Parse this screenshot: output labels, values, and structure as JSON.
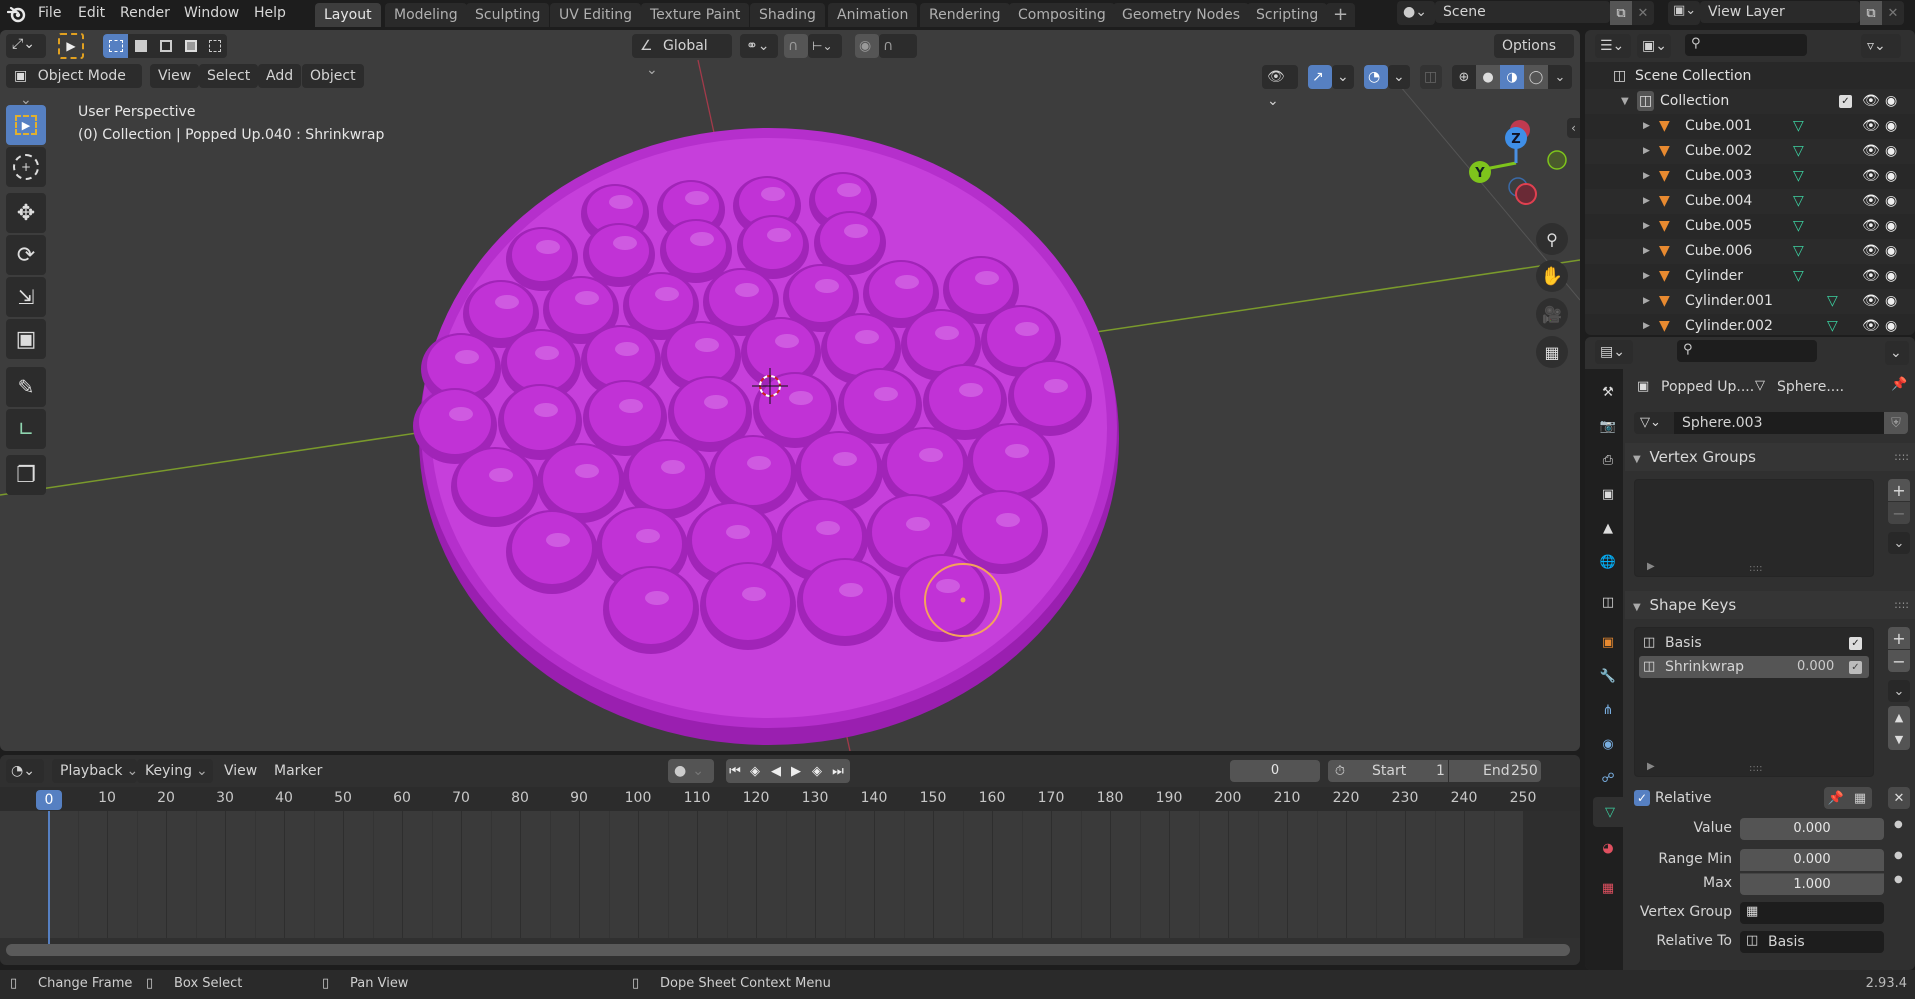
{
  "app": {
    "logo": "blender-logo-icon",
    "version": "2.93.4"
  },
  "topbar": {
    "menus": [
      "File",
      "Edit",
      "Render",
      "Window",
      "Help"
    ],
    "workspaces": [
      "Layout",
      "Modeling",
      "Sculpting",
      "UV Editing",
      "Texture Paint",
      "Shading",
      "Animation",
      "Rendering",
      "Compositing",
      "Geometry Nodes",
      "Scripting"
    ],
    "active_workspace": "Layout",
    "add_workspace": "+",
    "scene": "Scene",
    "view_layer": "View Layer"
  },
  "tool_settings": {
    "transform_orientation": "Global",
    "options_label": "Options"
  },
  "viewport": {
    "mode": "Object Mode",
    "menus": [
      "View",
      "Select",
      "Add",
      "Object"
    ],
    "info_line1": "User Perspective",
    "info_line2": "(0) Collection | Popped Up.040 : Shrinkwrap",
    "object_color": "#c132d6",
    "selection_color": "#f5a35b",
    "gizmo": {
      "x": "X",
      "y": "Y",
      "z": "Z"
    },
    "tools": [
      "select-box",
      "cursor",
      "move",
      "rotate",
      "scale",
      "transform",
      "annotate",
      "measure",
      "add-cube"
    ],
    "nav_buttons": [
      "zoom",
      "pan",
      "camera",
      "ortho-grid"
    ]
  },
  "outliner": {
    "root": "Scene Collection",
    "collection": "Collection",
    "items": [
      "Cube.001",
      "Cube.002",
      "Cube.003",
      "Cube.004",
      "Cube.005",
      "Cube.006",
      "Cylinder",
      "Cylinder.001",
      "Cylinder.002"
    ]
  },
  "properties": {
    "breadcrumb_object": "Popped Up....",
    "breadcrumb_data": "Sphere....",
    "mesh_name": "Sphere.003",
    "vertex_groups_title": "Vertex Groups",
    "shape_keys_title": "Shape Keys",
    "shape_keys": [
      {
        "name": "Basis",
        "value": "",
        "enabled": true
      },
      {
        "name": "Shrinkwrap",
        "value": "0.000",
        "enabled": true,
        "selected": true
      }
    ],
    "relative_label": "Relative",
    "relative_checked": true,
    "value_label": "Value",
    "value": "0.000",
    "range_min_label": "Range Min",
    "range_min": "0.000",
    "max_label": "Max",
    "max": "1.000",
    "vertex_group_label": "Vertex Group",
    "vertex_group_value": "",
    "relative_to_label": "Relative To",
    "relative_to_value": "Basis"
  },
  "timeline": {
    "menus": [
      "Playback",
      "Keying",
      "View",
      "Marker"
    ],
    "current_frame": "0",
    "start_label": "Start",
    "start": "1",
    "end_label": "End",
    "end": "250",
    "ticks": [
      "0",
      "10",
      "20",
      "30",
      "40",
      "50",
      "60",
      "70",
      "80",
      "90",
      "100",
      "110",
      "120",
      "130",
      "140",
      "150",
      "160",
      "170",
      "180",
      "190",
      "200",
      "210",
      "220",
      "230",
      "240",
      "250"
    ]
  },
  "statusbar": {
    "items": [
      "Change Frame",
      "Box Select",
      "Pan View",
      "Dope Sheet Context Menu"
    ]
  }
}
